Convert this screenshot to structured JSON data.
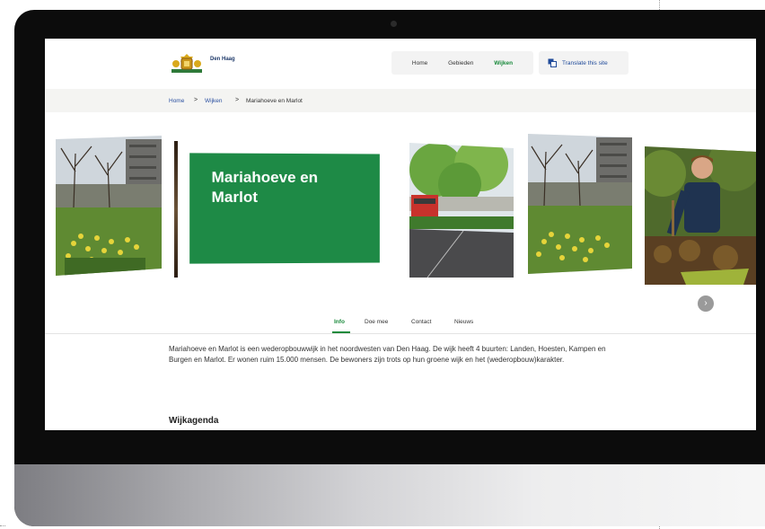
{
  "header": {
    "site_name": "Den Haag",
    "nav": [
      {
        "label": "Home",
        "active": false
      },
      {
        "label": "Gebieden",
        "active": false
      },
      {
        "label": "Wijken",
        "active": true
      }
    ],
    "translate_label": "Translate this site",
    "translate_icon": "translate-icon"
  },
  "breadcrumb": {
    "items": [
      "Home",
      "Wijken",
      "Mariahoeve en Marlot"
    ],
    "separator": ">"
  },
  "hero": {
    "title": "Mariahoeve en Marlot",
    "scroll_glyph": "›"
  },
  "tabs": {
    "items": [
      {
        "label": "Info",
        "active": true
      },
      {
        "label": "Doe mee",
        "active": false
      },
      {
        "label": "Contact",
        "active": false
      },
      {
        "label": "Nieuws",
        "active": false
      }
    ]
  },
  "content": {
    "intro": "Mariahoeve en Marlot is een wederopbouwwijk in het noordwesten van Den Haag. De wijk heeft 4 buurten: Landen, Hoesten, Kampen en Burgen en Marlot. Er wonen ruim 15.000 mensen. De bewoners zijn trots op hun groene wijk en het (wederopbouw)karakter.",
    "agenda_heading": "Wijkagenda"
  },
  "colors": {
    "brand_green": "#1e8a46",
    "link_blue": "#2a4fa0",
    "bezel": "#0c0c0c"
  }
}
